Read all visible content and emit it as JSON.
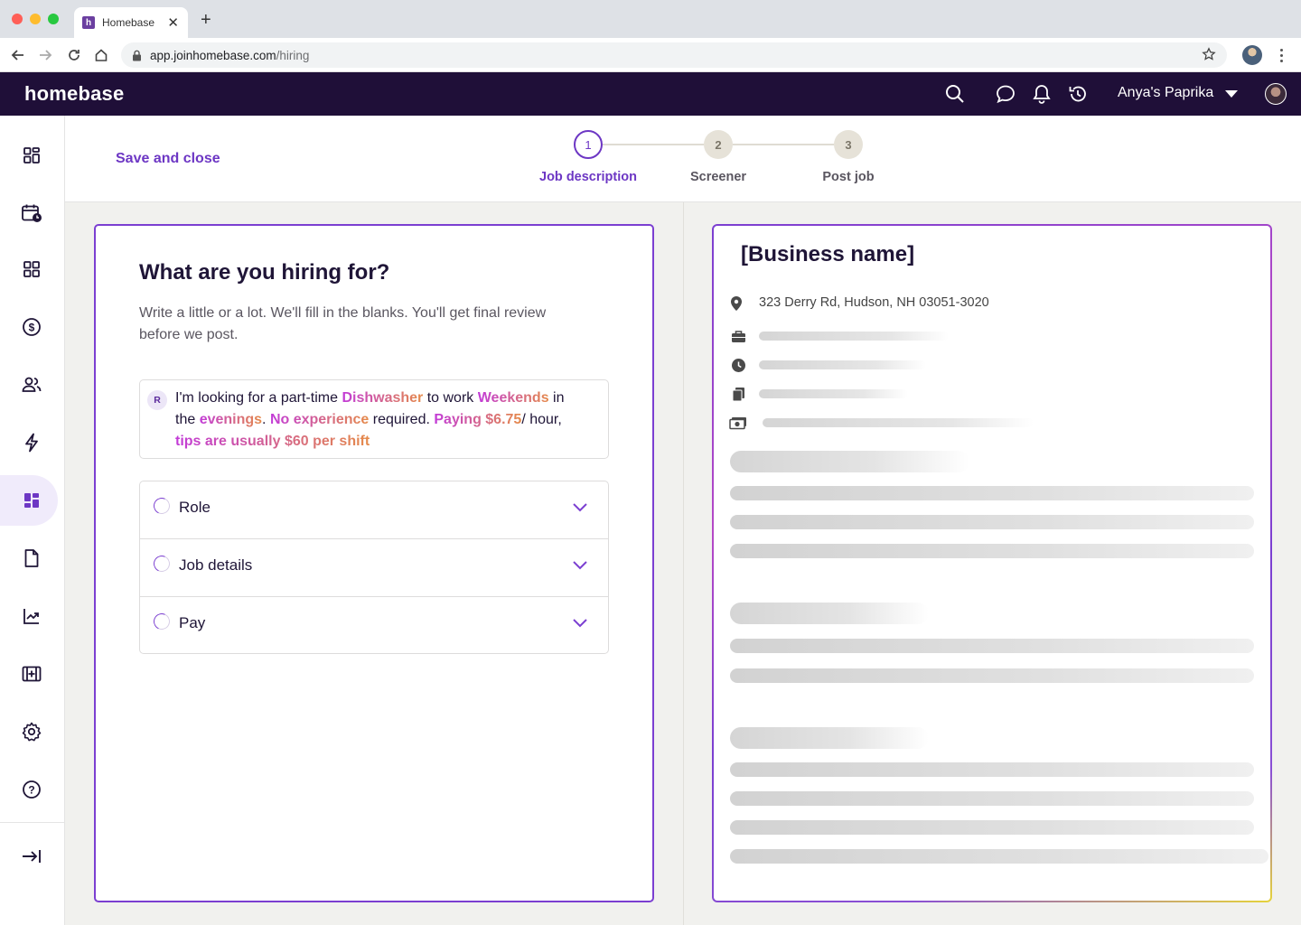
{
  "browser": {
    "tab_title": "Homebase",
    "favicon_letter": "h",
    "url_host": "app.joinhomebase.com",
    "url_path": "/hiring"
  },
  "app": {
    "brand": "homebase",
    "user_name": "Anya's Paprika",
    "header_icons": [
      "search-icon",
      "chat-icon",
      "bell-icon",
      "history-icon"
    ]
  },
  "sidebar": {
    "items": [
      {
        "name": "dashboard-icon",
        "active": false
      },
      {
        "name": "schedule-icon",
        "active": false
      },
      {
        "name": "apps-icon",
        "active": false
      },
      {
        "name": "payroll-icon",
        "active": false
      },
      {
        "name": "team-icon",
        "active": false
      },
      {
        "name": "lightning-icon",
        "active": false
      },
      {
        "name": "hiring-icon",
        "active": true
      },
      {
        "name": "document-icon",
        "active": false
      },
      {
        "name": "reports-icon",
        "active": false
      },
      {
        "name": "add-panel-icon",
        "active": false
      },
      {
        "name": "settings-icon",
        "active": false
      },
      {
        "name": "help-icon",
        "active": false
      }
    ],
    "collapse_icon": "collapse-icon"
  },
  "topbar": {
    "save_close": "Save and close",
    "steps": [
      {
        "number": "1",
        "label": "Job description",
        "active": true
      },
      {
        "number": "2",
        "label": "Screener",
        "active": false
      },
      {
        "number": "3",
        "label": "Post job",
        "active": false
      }
    ]
  },
  "form": {
    "title": "What are you hiring for?",
    "subtitle": "Write a little or a lot. We'll fill in the blanks. You'll get final review before we post.",
    "prompt_avatar": "R",
    "prompt_parts": {
      "p1": "I'm looking for a part-time ",
      "h1": "Dishwasher",
      "p2": " to work ",
      "h2": "Weekends",
      "p3": " in the ",
      "h3": "evenings",
      "p4": ". ",
      "h4": "No experience",
      "p5": " required. ",
      "h5": "Paying $6.75",
      "p6": "/ hour, ",
      "h6": "tips are usually $60 per shift"
    },
    "sections": [
      "Role",
      "Job details",
      "Pay"
    ]
  },
  "preview": {
    "business_name": "[Business name]",
    "address": "323 Derry Rd, Hudson, NH 03051-3020",
    "info_icons": [
      "briefcase-icon",
      "clock-icon",
      "copy-icon",
      "money-icon"
    ]
  },
  "colors": {
    "brand_dark": "#1f0f38",
    "accent": "#6d37c4",
    "highlight_start": "#c23bd8",
    "highlight_end": "#e58a4a"
  }
}
